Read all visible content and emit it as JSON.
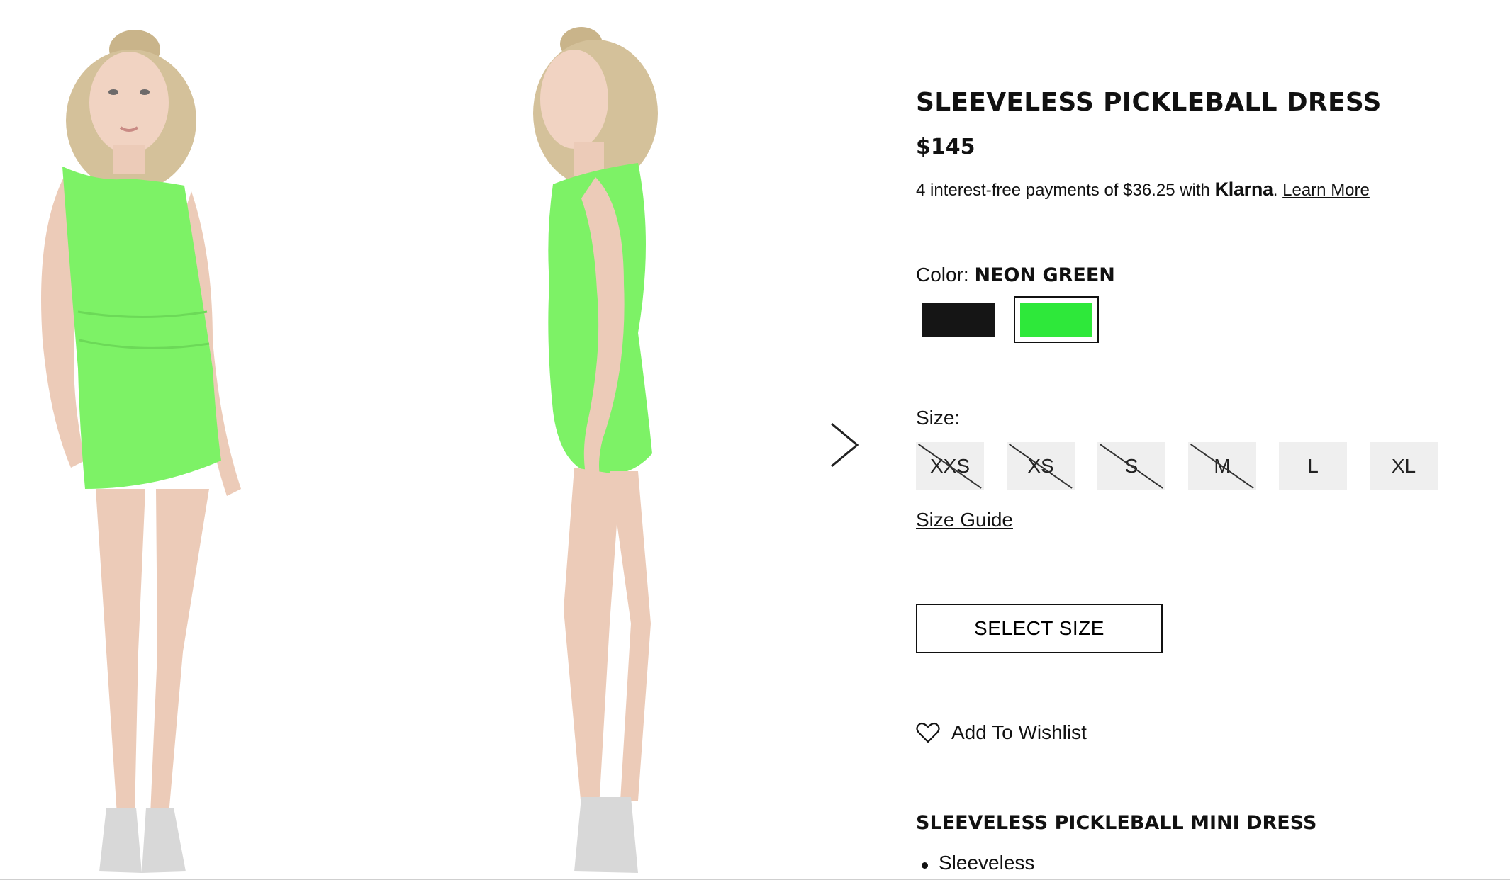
{
  "gallery": {
    "images": [
      {
        "alt": "front view",
        "icon": "model-photo-front"
      },
      {
        "alt": "side view",
        "icon": "model-photo-side"
      }
    ],
    "next_icon": "chevron-right-icon"
  },
  "product": {
    "title": "SLEEVELESS PICKLEBALL DRESS",
    "price": "$145",
    "klarna": {
      "prefix": "4 interest-free payments of $36.25 with ",
      "brand": "Klarna",
      "separator": ". ",
      "link": "Learn More"
    },
    "color": {
      "label": "Color: ",
      "selected": "NEON GREEN",
      "swatches": [
        {
          "name": "Black",
          "hex": "#151515",
          "selected": false
        },
        {
          "name": "Neon Green",
          "hex": "#2ee83a",
          "selected": true
        }
      ]
    },
    "size": {
      "label": "Size:",
      "options": [
        {
          "label": "XXS",
          "available": false
        },
        {
          "label": "XS",
          "available": false
        },
        {
          "label": "S",
          "available": false
        },
        {
          "label": "M",
          "available": false
        },
        {
          "label": "L",
          "available": true
        },
        {
          "label": "XL",
          "available": true
        }
      ],
      "guide": "Size Guide"
    },
    "select_size_label": "SELECT SIZE",
    "wishlist": {
      "label": "Add To Wishlist",
      "icon": "heart-icon"
    },
    "description": {
      "title": "SLEEVELESS PICKLEBALL MINI DRESS",
      "features": [
        "Sleeveless"
      ]
    }
  },
  "colors": {
    "dress": "#7df266",
    "text": "#111111",
    "size_bg": "#efefef"
  }
}
